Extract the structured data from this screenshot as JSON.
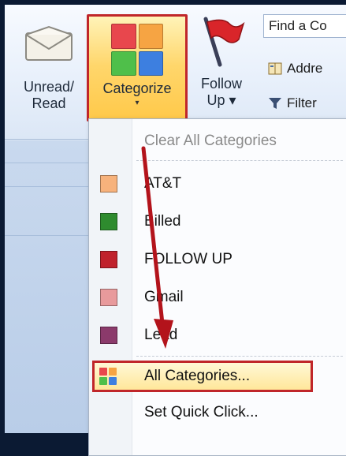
{
  "ribbon": {
    "unread_label": "Unread/\nRead",
    "categorize_label": "Categorize",
    "follow_label": "Follow\nUp ▾",
    "find_placeholder": "Find a Co",
    "address_label": "Addre",
    "filter_label": "Filter"
  },
  "menu": {
    "clear_all": "Clear All Categories",
    "categories": [
      {
        "label": "AT&T",
        "color": "#f7b27c"
      },
      {
        "label": "Billed",
        "color": "#2e8b2e"
      },
      {
        "label": "FOLLOW UP",
        "color": "#c0212c"
      },
      {
        "label": "Gmail",
        "color": "#e89a9c"
      },
      {
        "label": "Lead",
        "color": "#8b3a6b"
      }
    ],
    "all_categories": "All Categories...",
    "set_quick_click": "Set Quick Click..."
  },
  "colors": {
    "highlight_border": "#c0262a",
    "arrow": "#b3131b"
  }
}
